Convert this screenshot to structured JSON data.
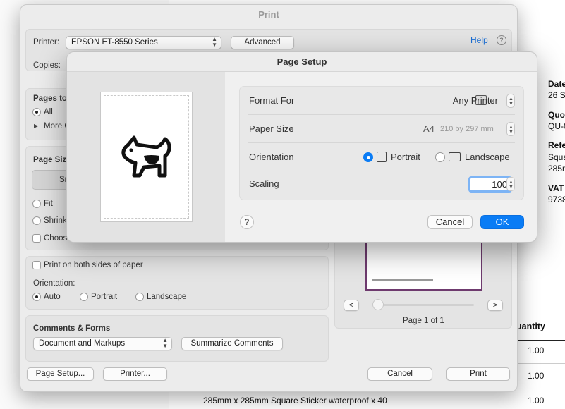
{
  "background_doc": {
    "right_labels": [
      {
        "bold": "Date",
        "value": "26 S"
      },
      {
        "bold": "Quo",
        "value": "QU-0"
      },
      {
        "bold": "Refe",
        "value": "Squa"
      },
      {
        "bold": "",
        "value": "285m"
      },
      {
        "bold": "VAT",
        "value": "9738"
      }
    ],
    "table_header": "uantity",
    "quantities": [
      "1.00",
      "1.00",
      "1.00"
    ],
    "bottom_line": "285mm x 285mm Square Sticker waterproof x 40"
  },
  "print_dialog": {
    "title": "Print",
    "printer_label": "Printer:",
    "printer_value": "EPSON ET-8550 Series",
    "advanced_button": "Advanced",
    "help_link": "Help",
    "help_icon": "question-circle-icon",
    "copies_label": "Copies:",
    "pages_label": "Pages to",
    "pages_all": "All",
    "more_label": "More C",
    "page_size_label": "Page Siz",
    "size_tab": "Si",
    "fit_label": "Fit",
    "shrink_label": "Shrink",
    "choose_label": "Choos",
    "both_sides_label": "Print on both sides of paper",
    "orientation_label": "Orientation:",
    "orient_auto": "Auto",
    "orient_portrait": "Portrait",
    "orient_landscape": "Landscape",
    "comments_heading": "Comments & Forms",
    "comments_value": "Document and Markups",
    "summarize_button": "Summarize Comments",
    "page_setup_button": "Page Setup...",
    "printer_button": "Printer...",
    "cancel_button": "Cancel",
    "print_button": "Print",
    "prev_button": "<",
    "next_button": ">",
    "page_indicator": "Page 1 of 1"
  },
  "page_setup": {
    "title": "Page Setup",
    "format_for_label": "Format For",
    "format_for_value": "Any Printer",
    "paper_size_label": "Paper Size",
    "paper_size_value": "A4",
    "paper_size_dims": "210 by 297 mm",
    "orientation_label": "Orientation",
    "portrait_label": "Portrait",
    "landscape_label": "Landscape",
    "scaling_label": "Scaling",
    "scaling_value": "100",
    "help_button": "?",
    "cancel_button": "Cancel",
    "ok_button": "OK"
  },
  "colors": {
    "accent": "#0a7cf5",
    "accent_focus": "#7db4f5"
  }
}
